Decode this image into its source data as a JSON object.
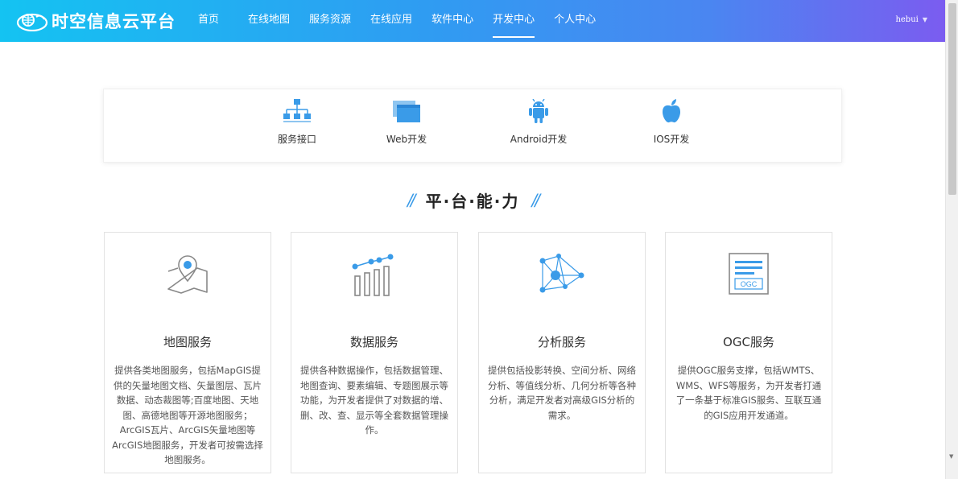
{
  "brand": {
    "name": "时空信息云平台"
  },
  "nav": {
    "items": [
      {
        "label": "首页"
      },
      {
        "label": "在线地图"
      },
      {
        "label": "服务资源"
      },
      {
        "label": "在线应用"
      },
      {
        "label": "软件中心"
      },
      {
        "label": "开发中心",
        "active": true
      },
      {
        "label": "个人中心"
      }
    ]
  },
  "user": {
    "name": "hebui"
  },
  "tools": {
    "items": [
      {
        "label": "服务接口",
        "icon": "sitemap-icon"
      },
      {
        "label": "Web开发",
        "icon": "web-window-icon"
      },
      {
        "label": "Android开发",
        "icon": "android-icon"
      },
      {
        "label": "IOS开发",
        "icon": "apple-icon"
      }
    ]
  },
  "section": {
    "title": "平·台·能·力",
    "slash_left": "//",
    "slash_right": "//"
  },
  "cards": [
    {
      "title": "地图服务",
      "icon": "map-pin-icon",
      "desc": "提供各类地图服务，包括MapGIS提供的矢量地图文档、矢量图层、瓦片数据、动态裁图等;百度地图、天地图、高德地图等开源地图服务；ArcGIS瓦片、ArcGIS矢量地图等ArcGIS地图服务，开发者可按需选择地图服务。"
    },
    {
      "title": "数据服务",
      "icon": "bar-trend-icon",
      "desc": "提供各种数据操作，包括数据管理、地图查询、要素编辑、专题图展示等功能，为开发者提供了对数据的增、删、改、查、显示等全套数据管理操作。"
    },
    {
      "title": "分析服务",
      "icon": "network-nodes-icon",
      "desc": "提供包括投影转换、空间分析、网络分析、等值线分析、几何分析等各种分析，满足开发者对高级GIS分析的需求。"
    },
    {
      "title": "OGC服务",
      "icon": "ogc-doc-icon",
      "icon_text": "OGC",
      "desc": "提供OGC服务支撑，包括WMTS、WMS、WFS等服务，为开发者打通了一条基于标准GIS服务、互联互通的GIS应用开发通道。"
    }
  ],
  "colors": {
    "accent": "#3a9be8",
    "header_start": "#14c3f2",
    "header_end": "#7b5cf0"
  }
}
